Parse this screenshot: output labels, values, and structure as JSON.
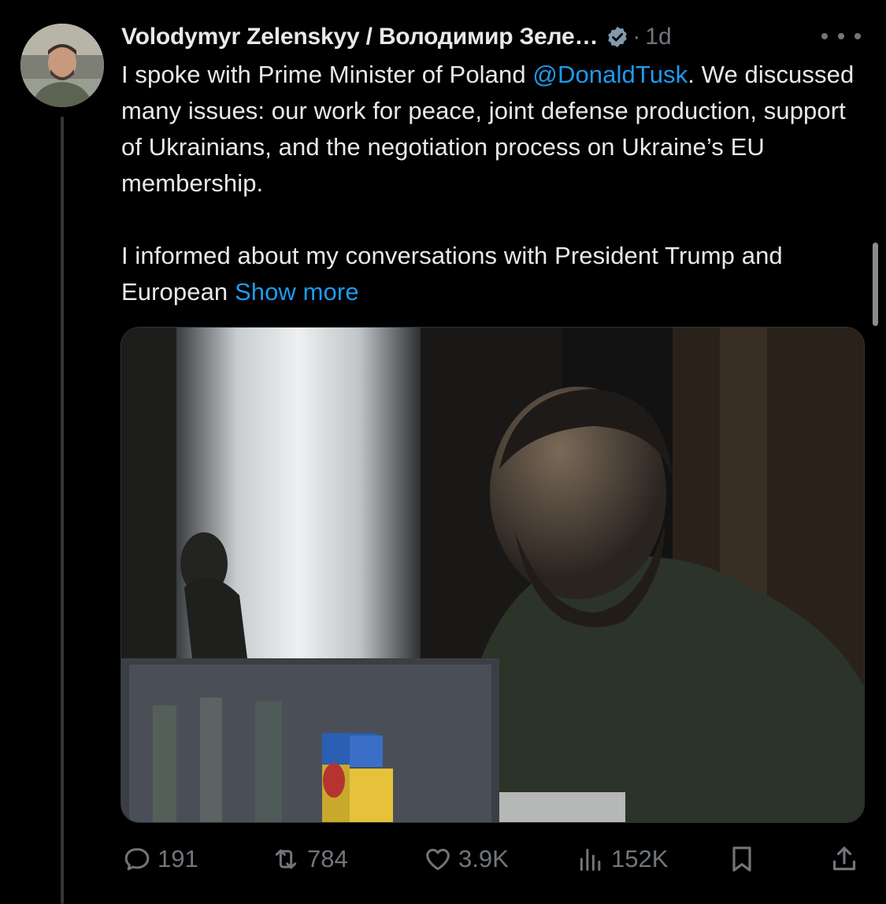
{
  "tweet": {
    "author": {
      "display_name": "Volodymyr Zelenskyy / Володимир Зеле…",
      "verified": true
    },
    "separator": "·",
    "timestamp": "1d",
    "text": {
      "p1_before": "I spoke with Prime Minister of Poland ",
      "mention": "@DonaldTusk",
      "p1_after": ". We discussed many issues: our work for peace, joint defense production, support of Ukrainians, and the negotiation process on Ukraine’s EU membership.",
      "p2": "I informed about my conversations with President Trump and European ",
      "show_more": "Show more"
    },
    "metrics": {
      "replies": "191",
      "reposts": "784",
      "likes": "3.9K",
      "views": "152K"
    }
  },
  "icons": {
    "verified": "verified-badge-icon",
    "more": "more-horizontal-icon",
    "reply": "reply-icon",
    "repost": "repost-icon",
    "like": "heart-icon",
    "views": "views-chart-icon",
    "bookmark": "bookmark-icon",
    "share": "share-icon"
  },
  "colors": {
    "background": "#000000",
    "text": "#e7e9ea",
    "muted": "#71767b",
    "link": "#1d9bf0",
    "verified_badge": "#829aab"
  }
}
